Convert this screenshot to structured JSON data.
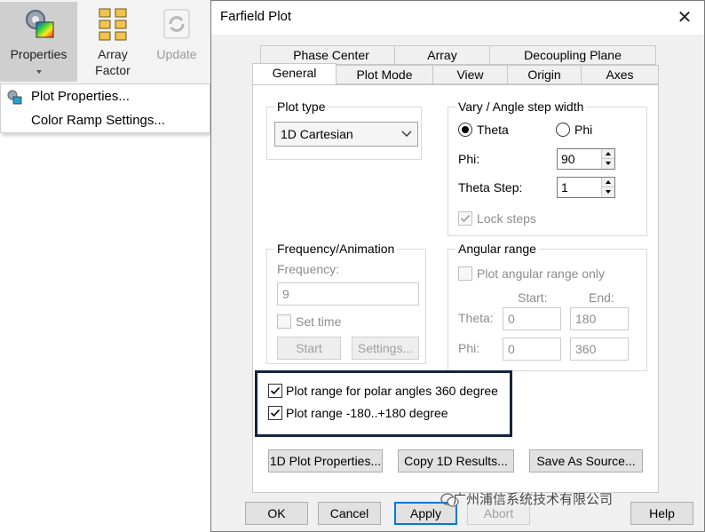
{
  "ribbon": {
    "buttons": [
      {
        "label": "Properties",
        "icon": "gear-color-ramp-icon"
      },
      {
        "label": "Array\nFactor",
        "label_line1": "Array",
        "label_line2": "Factor",
        "icon": "array-grid-icon"
      },
      {
        "label": "Update",
        "icon": "refresh-icon"
      }
    ]
  },
  "menu": {
    "items": [
      {
        "label": "Plot Properties...",
        "icon": "gear-color-ramp-icon"
      },
      {
        "label": "Color Ramp Settings..."
      }
    ]
  },
  "dialog": {
    "title": "Farfield Plot",
    "tabs_back": [
      "Phase Center",
      "Array",
      "Decoupling Plane"
    ],
    "tabs_front": [
      "General",
      "Plot Mode",
      "View",
      "Origin",
      "Axes"
    ],
    "active_tab": "General",
    "plot_type": {
      "group": "Plot type",
      "value": "1D Cartesian"
    },
    "vary": {
      "group": "Vary / Angle step width",
      "theta_label": "Theta",
      "phi_label": "Phi",
      "selected": "Theta",
      "phi_field_label": "Phi:",
      "phi_value": "90",
      "theta_step_label": "Theta Step:",
      "theta_step_value": "1",
      "lock_steps_label": "Lock steps",
      "lock_steps_checked": true
    },
    "frequency": {
      "group": "Frequency/Animation",
      "frequency_label": "Frequency:",
      "frequency_value": "9",
      "set_time_label": "Set time",
      "start_button": "Start",
      "settings_button": "Settings..."
    },
    "angular_range": {
      "group": "Angular range",
      "only_label": "Plot angular range only",
      "start_header": "Start:",
      "end_header": "End:",
      "theta_label": "Theta:",
      "theta_start": "0",
      "theta_end": "180",
      "phi_label": "Phi:",
      "phi_start": "0",
      "phi_end": "360"
    },
    "options": {
      "polar_360_label": "Plot range for polar angles 360 degree",
      "polar_360_checked": true,
      "range_180_label": "Plot range -180..+180 degree",
      "range_180_checked": true
    },
    "action_buttons": [
      "1D Plot Properties...",
      "Copy 1D Results...",
      "Save As Source..."
    ],
    "footer_buttons": {
      "ok": "OK",
      "cancel": "Cancel",
      "apply": "Apply",
      "abort": "Abort",
      "help": "Help"
    },
    "highlight_color": "#14233f"
  },
  "watermark": {
    "text": "广州浦信系统技术有限公司",
    "icon": "wechat-icon"
  }
}
